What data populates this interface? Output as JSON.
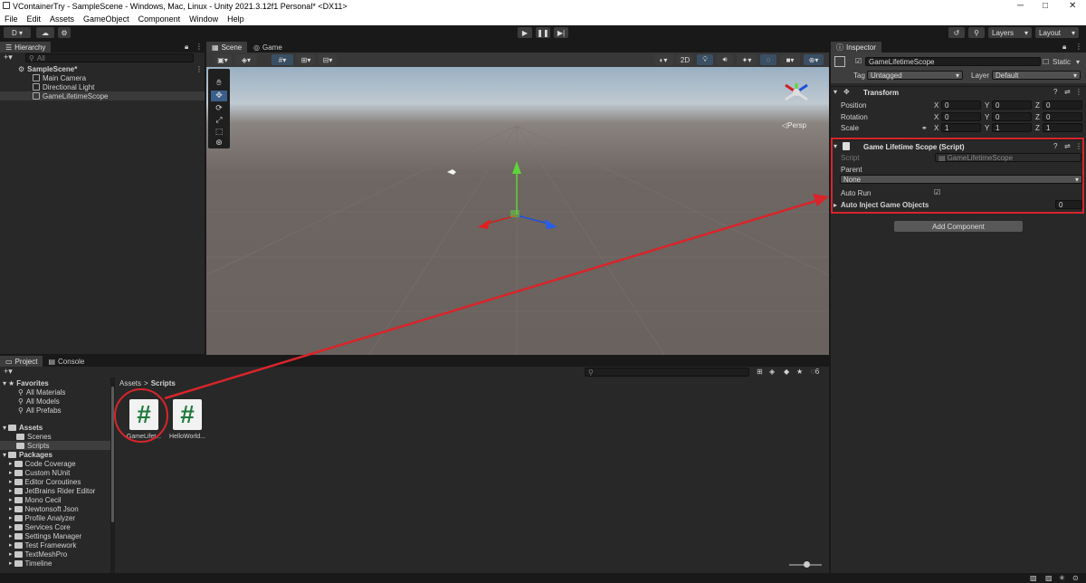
{
  "titlebar": {
    "title": "VContainerTry - SampleScene - Windows, Mac, Linux - Unity 2021.3.12f1 Personal* <DX11>"
  },
  "menu": [
    "File",
    "Edit",
    "Assets",
    "GameObject",
    "Component",
    "Window",
    "Help"
  ],
  "toolbar": {
    "account": "D ▾",
    "layers": "Layers",
    "layout": "Layout"
  },
  "hierarchy": {
    "tab": "Hierarchy",
    "search_placeholder": "All",
    "scene": "SampleScene*",
    "objects": [
      "Main Camera",
      "Directional Light",
      "GameLifetimeScope"
    ]
  },
  "scene_tabs": {
    "scene": "Scene",
    "game": "Game"
  },
  "scene_view": {
    "btn_2d": "2D",
    "persp": "◁Persp"
  },
  "inspector": {
    "tab": "Inspector",
    "object_name": "GameLifetimeScope",
    "static": "Static",
    "tag_label": "Tag",
    "tag_value": "Untagged",
    "layer_label": "Layer",
    "layer_value": "Default",
    "transform": {
      "header": "Transform",
      "position": {
        "label": "Position",
        "x": "0",
        "y": "0",
        "z": "0"
      },
      "rotation": {
        "label": "Rotation",
        "x": "0",
        "y": "0",
        "z": "0"
      },
      "scale": {
        "label": "Scale",
        "x": "1",
        "y": "1",
        "z": "1"
      }
    },
    "component": {
      "header": "Game Lifetime Scope (Script)",
      "script_label": "Script",
      "script_value": "GameLifetimeScope",
      "parent_label": "Parent",
      "parent_value": "None",
      "autorun_label": "Auto Run",
      "autoinject_label": "Auto Inject Game Objects",
      "autoinject_value": "0"
    },
    "add_component": "Add Component"
  },
  "project": {
    "tab_project": "Project",
    "tab_console": "Console",
    "favorites": {
      "label": "Favorites",
      "items": [
        "All Materials",
        "All Models",
        "All Prefabs"
      ]
    },
    "assets": {
      "label": "Assets",
      "items": [
        "Scenes",
        "Scripts"
      ]
    },
    "packages": {
      "label": "Packages",
      "items": [
        "Code Coverage",
        "Custom NUnit",
        "Editor Coroutines",
        "JetBrains Rider Editor",
        "Mono Cecil",
        "Newtonsoft Json",
        "Profile Analyzer",
        "Services Core",
        "Settings Manager",
        "Test Framework",
        "TextMeshPro",
        "Timeline"
      ]
    },
    "breadcrumb": {
      "root": "Assets",
      "sep": ">",
      "current": "Scripts"
    },
    "hidden_count": "6",
    "files": [
      {
        "name": "GameLifet...",
        "glyph": "#"
      },
      {
        "name": "HelloWorld...",
        "glyph": "#"
      }
    ]
  },
  "colors": {
    "annotation": "#d9242b",
    "script_icon": "#1e7a3c"
  }
}
